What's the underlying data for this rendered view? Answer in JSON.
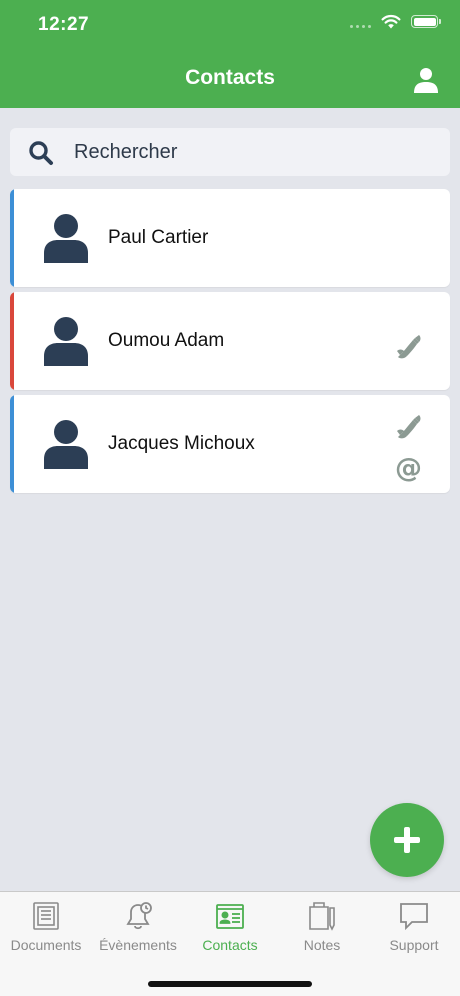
{
  "status_bar": {
    "time": "12:27"
  },
  "header": {
    "title": "Contacts"
  },
  "search": {
    "placeholder": "Rechercher"
  },
  "contacts": [
    {
      "name": "Paul Cartier",
      "accent": "#3d8fd6",
      "has_phone": false,
      "has_email": false
    },
    {
      "name": "Oumou Adam",
      "accent": "#d9473b",
      "has_phone": true,
      "has_email": false
    },
    {
      "name": "Jacques Michoux",
      "accent": "#3d8fd6",
      "has_phone": true,
      "has_email": true
    }
  ],
  "email_symbol": "@",
  "tabs": [
    {
      "label": "Documents",
      "icon": "documents-icon",
      "active": false
    },
    {
      "label": "Évènements",
      "icon": "bell-icon",
      "active": false
    },
    {
      "label": "Contacts",
      "icon": "contact-card-icon",
      "active": true
    },
    {
      "label": "Notes",
      "icon": "notes-icon",
      "active": false
    },
    {
      "label": "Support",
      "icon": "chat-bubble-icon",
      "active": false
    }
  ],
  "colors": {
    "brand": "#4caf50",
    "background": "#e3e5eb",
    "avatar": "#2c3e55",
    "action_icon": "#8c9a93",
    "tab_inactive": "#8a8a8a"
  }
}
